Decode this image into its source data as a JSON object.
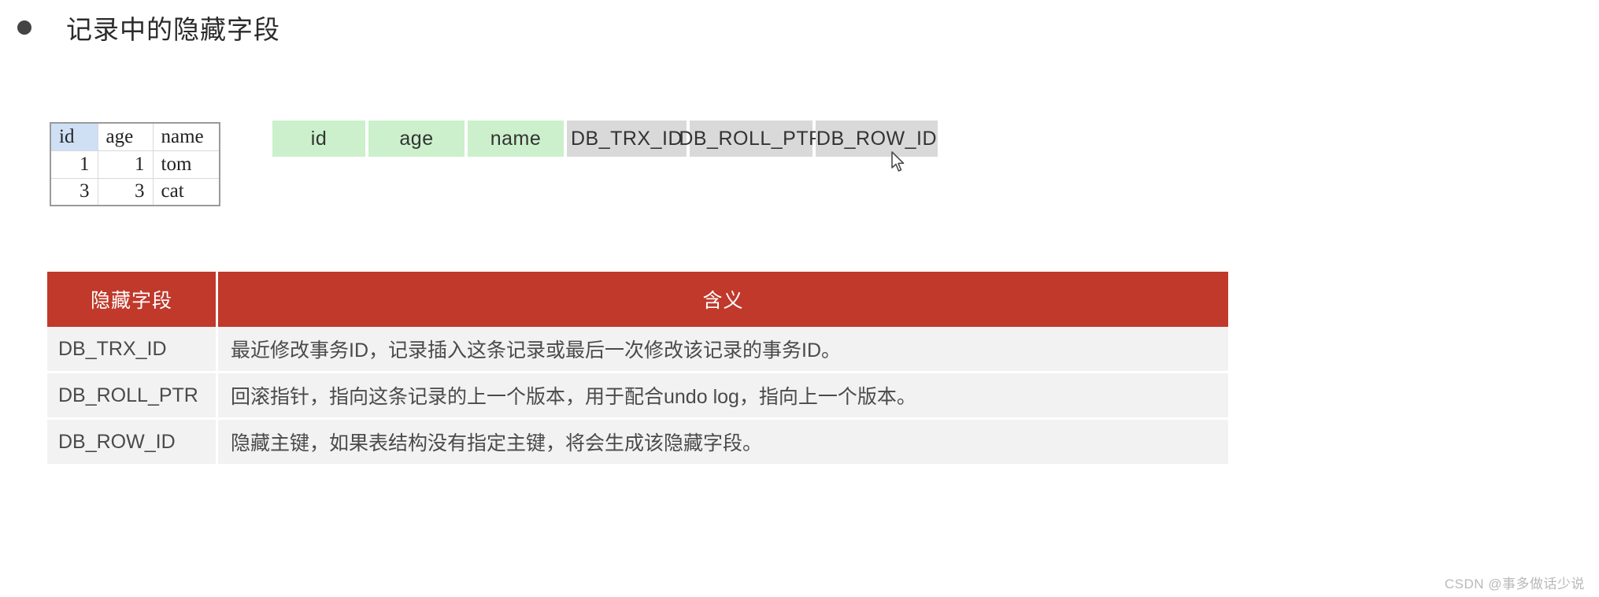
{
  "heading": {
    "bullet": "bullet-icon",
    "text": "记录中的隐藏字段"
  },
  "record_table": {
    "columns": [
      "id",
      "age",
      "name"
    ],
    "selected_column": "id",
    "rows": [
      {
        "id": "1",
        "age": "1",
        "name": "tom"
      },
      {
        "id": "3",
        "age": "3",
        "name": "cat"
      }
    ]
  },
  "field_boxes": {
    "visible_color": "#ccf0cc",
    "hidden_color": "#d9d9d9",
    "items": [
      {
        "label": "id",
        "kind": "visible"
      },
      {
        "label": "age",
        "kind": "visible"
      },
      {
        "label": "name",
        "kind": "visible"
      },
      {
        "label": "DB_TRX_ID",
        "kind": "hidden"
      },
      {
        "label": "DB_ROLL_PTR",
        "kind": "hidden"
      },
      {
        "label": "DB_ROW_ID",
        "kind": "hidden"
      }
    ]
  },
  "desc_table": {
    "header_color": "#c0392b",
    "headers": {
      "field": "隐藏字段",
      "meaning": "含义"
    },
    "rows": [
      {
        "field": "DB_TRX_ID",
        "meaning": "最近修改事务ID，记录插入这条记录或最后一次修改该记录的事务ID。"
      },
      {
        "field": "DB_ROLL_PTR",
        "meaning": "回滚指针，指向这条记录的上一个版本，用于配合undo log，指向上一个版本。"
      },
      {
        "field": "DB_ROW_ID",
        "meaning": "隐藏主键，如果表结构没有指定主键，将会生成该隐藏字段。"
      }
    ]
  },
  "watermark": "CSDN @事多做话少说"
}
